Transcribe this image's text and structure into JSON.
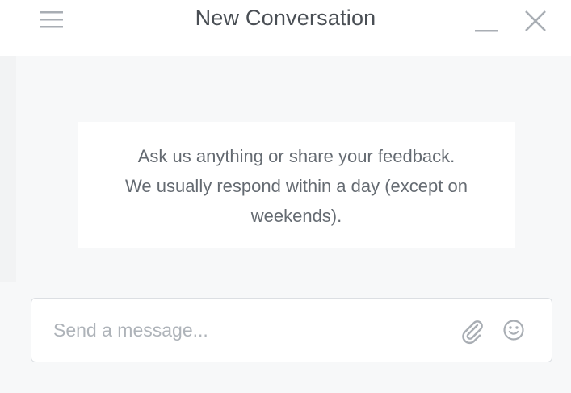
{
  "header": {
    "title": "New Conversation",
    "icons": {
      "menu": "hamburger-menu-icon",
      "minimize": "minimize-icon",
      "close": "close-icon"
    }
  },
  "intro": {
    "lines": [
      "Ask us anything or share your feedback.",
      "We usually respond within a day (except on",
      "weekends)."
    ]
  },
  "composer": {
    "placeholder": "Send a message...",
    "value": "",
    "icons": {
      "attach": "paperclip-icon",
      "emoji": "emoji-icon"
    }
  },
  "colors": {
    "header_bg": "#ffffff",
    "body_bg": "#f7f8f9",
    "title_text": "#4a4f55",
    "icon_gray": "#a9aeb4",
    "intro_text": "#656b72",
    "placeholder": "#aeb3b9"
  }
}
